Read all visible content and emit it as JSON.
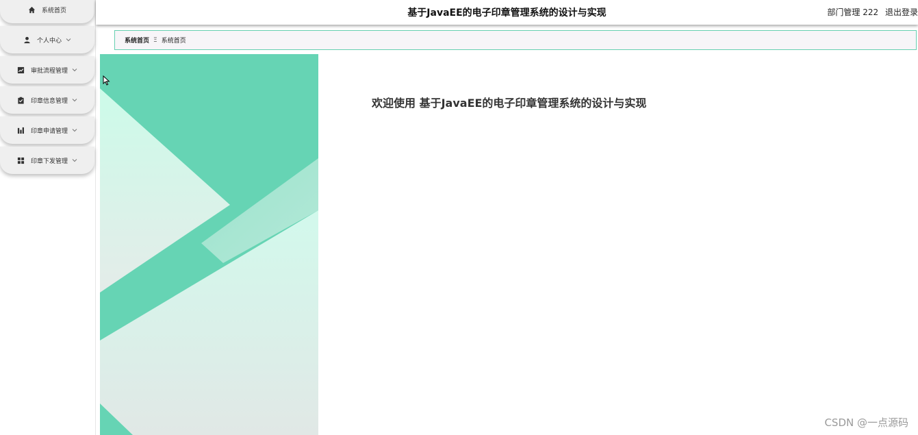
{
  "app": {
    "title": "基于JavaEE的电子印章管理系统的设计与实现",
    "accent_color": "#66d4b4",
    "border_color": "#66cfb0"
  },
  "header": {
    "user_label": "部门管理 222",
    "logout_label": "退出登录"
  },
  "sidebar": {
    "items": [
      {
        "label": "系统首页",
        "icon": "home-icon",
        "has_submenu": false
      },
      {
        "label": "个人中心",
        "icon": "user-icon",
        "has_submenu": true
      },
      {
        "label": "审批流程管理",
        "icon": "chart-icon",
        "has_submenu": true
      },
      {
        "label": "印章信息管理",
        "icon": "clipboard-check-icon",
        "has_submenu": true
      },
      {
        "label": "印章申请管理",
        "icon": "bar-chart-icon",
        "has_submenu": true
      },
      {
        "label": "印章下发管理",
        "icon": "grid-icon",
        "has_submenu": true
      }
    ]
  },
  "breadcrumb": {
    "root": "系统首页",
    "separator": "Ξ",
    "current": "系统首页"
  },
  "main": {
    "welcome_prefix": "欢迎使用",
    "welcome_title": "基于JavaEE的电子印章管理系统的设计与实现"
  },
  "watermark": "CSDN @一点源码"
}
